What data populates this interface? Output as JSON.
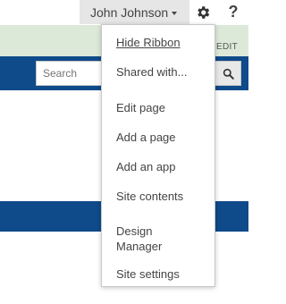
{
  "suite_bar": {
    "user_name": "John Johnson",
    "help_label": "?"
  },
  "ribbon": {
    "edit_label": "EDIT"
  },
  "search": {
    "placeholder": "Search"
  },
  "settings_menu": {
    "items": [
      {
        "label": "Hide Ribbon"
      },
      {
        "label": "Shared with..."
      },
      {
        "label": "Edit page"
      },
      {
        "label": "Add a page"
      },
      {
        "label": "Add an app"
      },
      {
        "label": "Site contents"
      },
      {
        "label": "Design Manager"
      },
      {
        "label": "Site settings"
      }
    ]
  },
  "colors": {
    "header_blue": "#0f4a8a",
    "ribbon_green": "#dde9d8",
    "user_menu_bg": "#e6e6e6"
  },
  "icons": {
    "settings": "gear-icon",
    "search": "magnifier-icon",
    "user_dropdown": "caret-down-icon"
  }
}
